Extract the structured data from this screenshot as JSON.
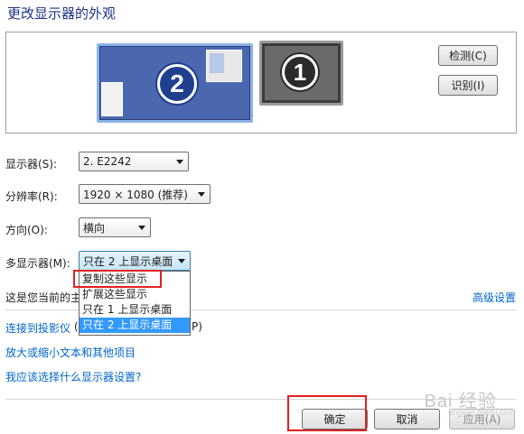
{
  "header": {
    "title": "更改显示器的外观"
  },
  "preview": {
    "monitor_2_number": "2",
    "monitor_1_number": "1",
    "detect_button": "检测(C)",
    "identify_button": "识别(I)"
  },
  "settings": {
    "display_label": "显示器(S):",
    "display_value": "2. E2242",
    "resolution_label": "分辨率(R):",
    "resolution_value": "1920 × 1080 (推荐)",
    "orientation_label": "方向(O):",
    "orientation_value": "横向",
    "multi_label": "多显示器(M):",
    "multi_value": "只在 2 上显示桌面",
    "multi_options": [
      "复制这些显示",
      "扩展这些显示",
      "只在 1 上显示桌面",
      "只在 2 上显示桌面"
    ],
    "current_text": "这是您当前的主",
    "advanced_link": "高级设置"
  },
  "links": {
    "projector": "连接到投影仪",
    "projector_tail": "P)",
    "projector_mid": "(",
    "text_size": "放大或缩小文本和其他项目",
    "which_settings": "我应该选择什么显示器设置?"
  },
  "footer": {
    "ok": "确定",
    "cancel": "取消",
    "apply": "应用(A)"
  },
  "watermark": {
    "text": "Bai 经验",
    "sub": "jingyan.baidu.com"
  }
}
